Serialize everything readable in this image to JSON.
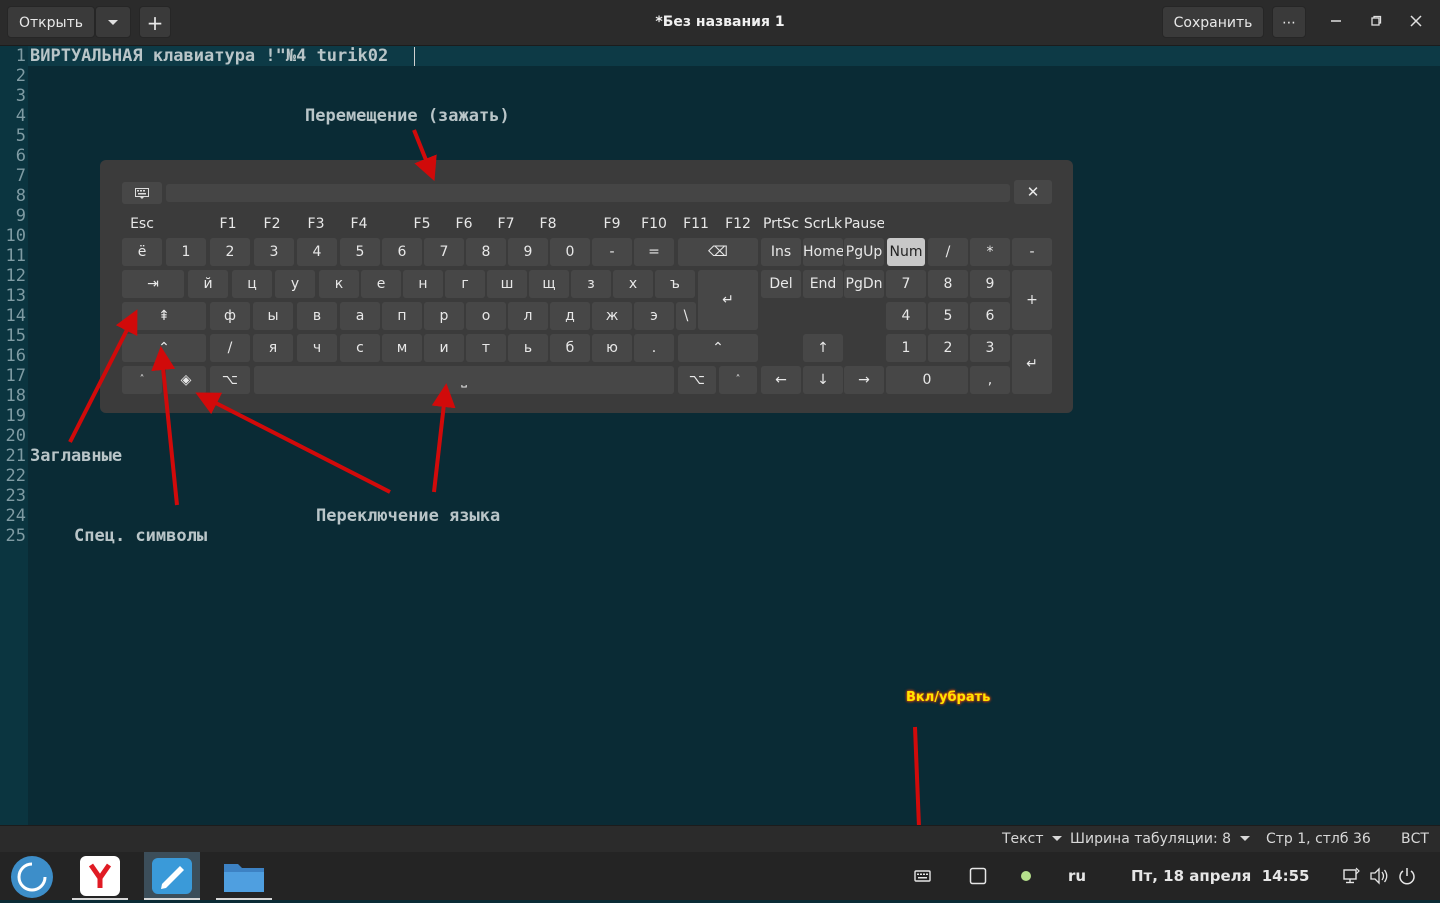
{
  "titlebar": {
    "open_label": "Открыть",
    "add_label": "+",
    "title": "*Без названия 1",
    "save_label": "Сохранить",
    "more_label": "⋯"
  },
  "editor": {
    "line_numbers": [
      "1",
      "2",
      "3",
      "4",
      "5",
      "6",
      "7",
      "8",
      "9",
      "10",
      "11",
      "12",
      "13",
      "14",
      "15",
      "16",
      "17",
      "18",
      "19",
      "20",
      "21",
      "22",
      "23",
      "24",
      "25"
    ],
    "text_line1": "ВИРТУАЛЬНАЯ клавиатура !\"№4 turik02",
    "annotations": {
      "move": "Перемещение (зажать)",
      "caps": "Заглавные",
      "special": "Спец. символы",
      "lang_switch": "Переключение языка",
      "toggle": "Вкл/убрать"
    }
  },
  "keyboard": {
    "row_f": [
      "Esc",
      "F1",
      "F2",
      "F3",
      "F4",
      "F5",
      "F6",
      "F7",
      "F8",
      "F9",
      "F10",
      "F11",
      "F12",
      "PrtSc",
      "ScrLk",
      "Pause"
    ],
    "row_num": [
      "ё",
      "1",
      "2",
      "3",
      "4",
      "5",
      "6",
      "7",
      "8",
      "9",
      "0",
      "-",
      "=",
      "⌫"
    ],
    "row_q": [
      "⇥",
      "й",
      "ц",
      "у",
      "к",
      "е",
      "н",
      "г",
      "ш",
      "щ",
      "з",
      "х",
      "ъ",
      "↵"
    ],
    "row_a": [
      "⇞",
      "ф",
      "ы",
      "в",
      "а",
      "п",
      "р",
      "о",
      "л",
      "д",
      "ж",
      "э",
      "\\"
    ],
    "row_z": [
      "⌃",
      "/",
      "я",
      "ч",
      "с",
      "м",
      "и",
      "т",
      "ь",
      "б",
      "ю",
      ".",
      "⌃"
    ],
    "row_bottom": [
      "˄",
      "◈",
      "⌥",
      "⎵",
      "⌥",
      "˄"
    ],
    "nav_top": [
      "Ins",
      "Home",
      "PgUp"
    ],
    "nav_mid": [
      "Del",
      "End",
      "PgDn"
    ],
    "arrows": [
      "↑",
      "←",
      "↓",
      "→"
    ],
    "numpad_top": [
      "Num",
      "/",
      "*",
      "-"
    ],
    "numpad_r1": [
      "7",
      "8",
      "9",
      "+"
    ],
    "numpad_r2": [
      "4",
      "5",
      "6"
    ],
    "numpad_r3": [
      "1",
      "2",
      "3",
      "↵"
    ],
    "numpad_r4": [
      "0",
      ","
    ],
    "close": "✕"
  },
  "statusbar": {
    "syntax": "Текст",
    "tab_width": "Ширина табуляции: 8",
    "position": "Стр 1, стлб 36",
    "insert_mode": "ВСТ"
  },
  "taskbar": {
    "lang": "ru",
    "clock": "Пт, 18 апреля  14:55",
    "apps": [
      "Яндекс Браузер",
      "Текстовый редактор",
      "Файлы"
    ]
  },
  "colors": {
    "editor_bg": "#0a2b35",
    "arrow": "#d10a0a",
    "toggle_label": "#ffe500"
  }
}
